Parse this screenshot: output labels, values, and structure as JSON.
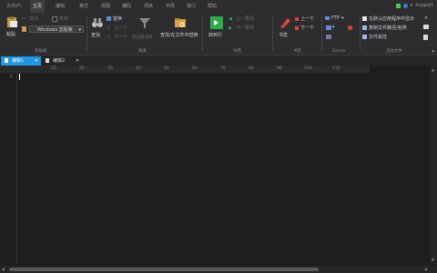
{
  "menu": {
    "items": [
      "文件(F)",
      "主页",
      "编辑",
      "格式",
      "视图",
      "编码",
      "项目",
      "布局",
      "窗口",
      "帮助"
    ],
    "active": "主页"
  },
  "titlebar": {
    "support_label": "Support"
  },
  "ribbon": {
    "clipboard": {
      "paste_label": "粘贴",
      "cut_label": "剪切",
      "copy_label": "复制",
      "combo_value": "Windows 剪贴板",
      "group_label": "剪贴板"
    },
    "search": {
      "find_label": "查找",
      "replace_label": "替换",
      "prev_label": "上一个",
      "next_label": "下一个",
      "filter_label": "筛选器消除",
      "find_in_files_label": "查找/在文件中替换",
      "group_label": "搜索"
    },
    "navigation": {
      "goto_label": "转到行",
      "prev_label": "上一更改",
      "next_label": "下一更改",
      "group_label": "导航"
    },
    "bookmarks": {
      "bookmark_label": "书签",
      "prev_label": "上一个",
      "next_label": "下一个",
      "group_label": "书签"
    },
    "extras": {
      "ftp_label": "FTP",
      "group_label": "Extras"
    },
    "active_file": {
      "show_in_default_label": "在默认应用程序中显示",
      "copy_path_label": "复制文件路径/名称",
      "properties_label": "文件属性",
      "group_label": "活动文件"
    }
  },
  "tabs": [
    {
      "label": "编辑1",
      "active": true
    },
    {
      "label": "编辑2",
      "active": false
    }
  ],
  "ruler": {
    "ticks": [
      "10",
      "20",
      "30",
      "40",
      "50",
      "60",
      "70",
      "80",
      "90",
      "100",
      "110"
    ]
  },
  "editor": {
    "line_number": "1"
  },
  "colors": {
    "accent": "#1c97ea",
    "background": "#1e1e1e",
    "chrome": "#2d2d30"
  }
}
